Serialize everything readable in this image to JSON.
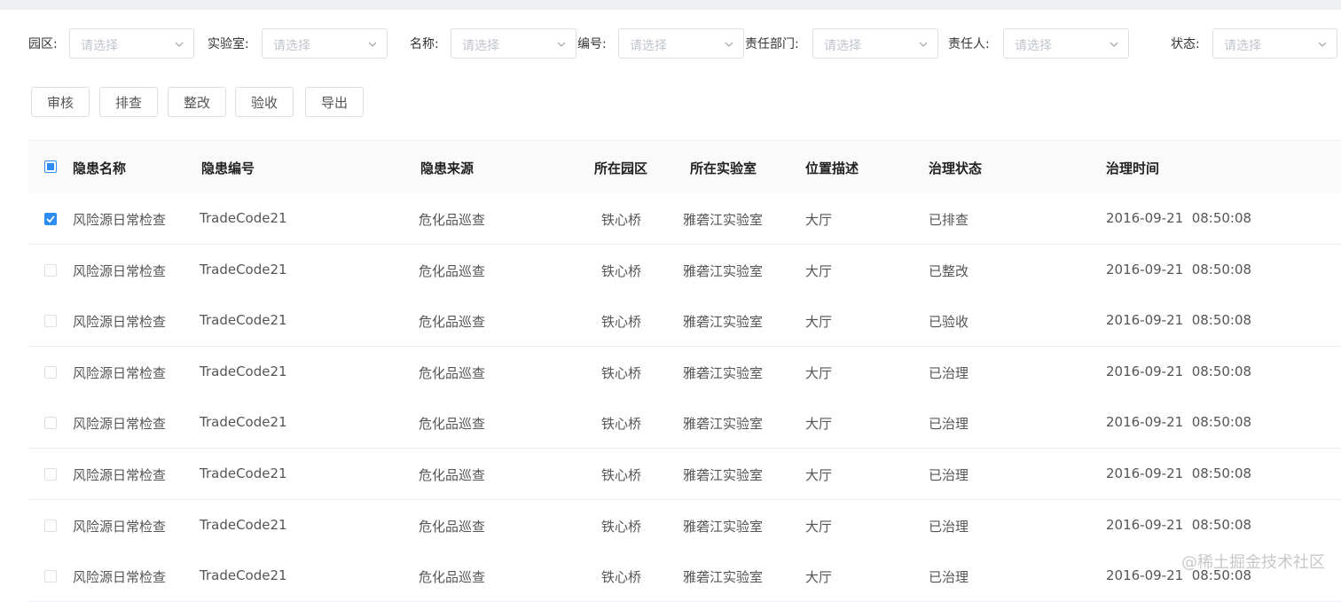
{
  "filters": [
    {
      "label": "园区:",
      "placeholder": "请选择"
    },
    {
      "label": "实验室:",
      "placeholder": "请选择"
    },
    {
      "label": "名称:",
      "placeholder": "请选择"
    },
    {
      "label": "编号:",
      "placeholder": "请选择"
    },
    {
      "label": "责任部门:",
      "placeholder": "请选择"
    },
    {
      "label": "责任人:",
      "placeholder": "请选择"
    },
    {
      "label": "状态:",
      "placeholder": "请选择"
    }
  ],
  "actions": [
    "审核",
    "排查",
    "整改",
    "验收",
    "导出"
  ],
  "table": {
    "header_checkbox": "indeterminate",
    "columns": [
      "隐患名称",
      "隐患编号",
      "隐患来源",
      "所在园区",
      "所在实验室",
      "位置描述",
      "治理状态",
      "治理时间"
    ],
    "rows": [
      {
        "checked": true,
        "name": "风险源日常检查",
        "code": "TradeCode21",
        "source": "危化品巡查",
        "campus": "铁心桥",
        "lab": "雅砻江实验室",
        "location": "大厅",
        "status": "已排查",
        "time": "2016-09-21  08:50:08"
      },
      {
        "checked": false,
        "name": "风险源日常检查",
        "code": "TradeCode21",
        "source": "危化品巡查",
        "campus": "铁心桥",
        "lab": "雅砻江实验室",
        "location": "大厅",
        "status": "已整改",
        "time": "2016-09-21  08:50:08"
      },
      {
        "checked": false,
        "name": "风险源日常检查",
        "code": "TradeCode21",
        "source": "危化品巡查",
        "campus": "铁心桥",
        "lab": "雅砻江实验室",
        "location": "大厅",
        "status": "已验收",
        "time": "2016-09-21  08:50:08"
      },
      {
        "checked": false,
        "name": "风险源日常检查",
        "code": "TradeCode21",
        "source": "危化品巡查",
        "campus": "铁心桥",
        "lab": "雅砻江实验室",
        "location": "大厅",
        "status": "已治理",
        "time": "2016-09-21  08:50:08"
      },
      {
        "checked": false,
        "name": "风险源日常检查",
        "code": "TradeCode21",
        "source": "危化品巡查",
        "campus": "铁心桥",
        "lab": "雅砻江实验室",
        "location": "大厅",
        "status": "已治理",
        "time": "2016-09-21  08:50:08"
      },
      {
        "checked": false,
        "name": "风险源日常检查",
        "code": "TradeCode21",
        "source": "危化品巡查",
        "campus": "铁心桥",
        "lab": "雅砻江实验室",
        "location": "大厅",
        "status": "已治理",
        "time": "2016-09-21  08:50:08"
      },
      {
        "checked": false,
        "name": "风险源日常检查",
        "code": "TradeCode21",
        "source": "危化品巡查",
        "campus": "铁心桥",
        "lab": "雅砻江实验室",
        "location": "大厅",
        "status": "已治理",
        "time": "2016-09-21  08:50:08"
      },
      {
        "checked": false,
        "name": "风险源日常检查",
        "code": "TradeCode21",
        "source": "危化品巡查",
        "campus": "铁心桥",
        "lab": "雅砻江实验室",
        "location": "大厅",
        "status": "已治理",
        "time": "2016-09-21  08:50:08"
      }
    ]
  },
  "watermark": "@稀土掘金技术社区",
  "colors": {
    "accent": "#2d8cf0",
    "border": "#dcdfe6",
    "placeholder": "#c0c4cc"
  }
}
